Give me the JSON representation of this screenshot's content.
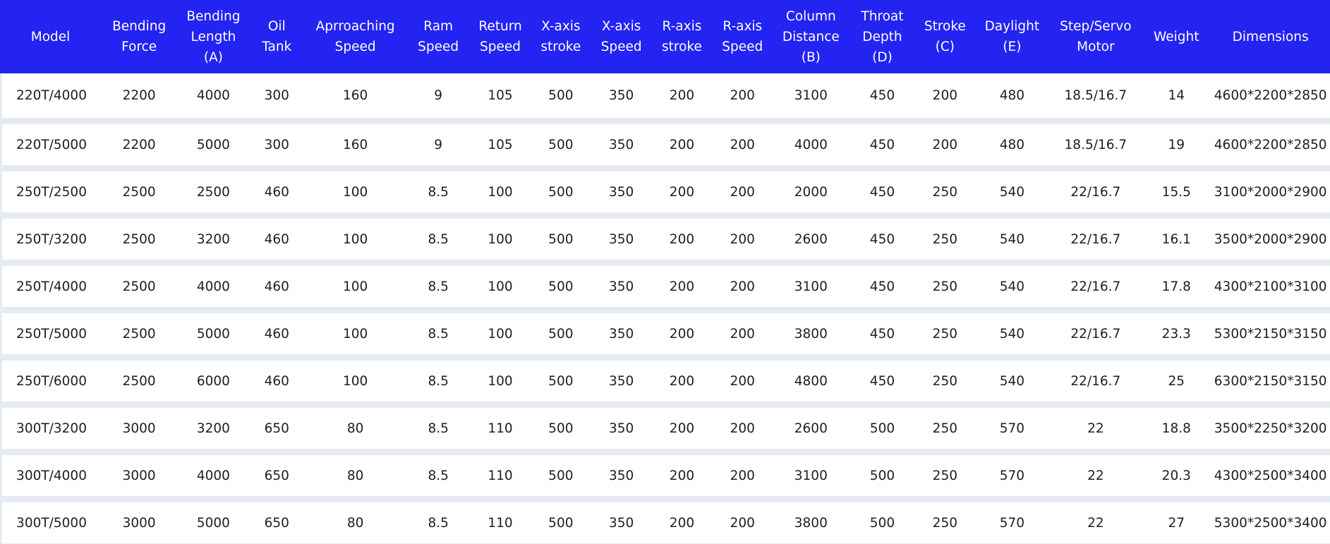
{
  "table": {
    "headers": [
      [
        "Model"
      ],
      [
        "Bending",
        "Force"
      ],
      [
        "Bending",
        "Length",
        "(A)"
      ],
      [
        "Oil",
        "Tank"
      ],
      [
        "Aprroaching",
        "Speed"
      ],
      [
        "Ram",
        "Speed"
      ],
      [
        "Return",
        "Speed"
      ],
      [
        "X-axis",
        "stroke"
      ],
      [
        "X-axis",
        "Speed"
      ],
      [
        "R-axis",
        "stroke"
      ],
      [
        "R-axis",
        "Speed"
      ],
      [
        "Column",
        "Distance",
        "(B)"
      ],
      [
        "Throat",
        "Depth",
        "(D)"
      ],
      [
        "Stroke",
        "(C)"
      ],
      [
        "Daylight",
        "(E)"
      ],
      [
        "Step/Servo",
        "Motor"
      ],
      [
        "Weight"
      ],
      [
        "Dimensions"
      ]
    ],
    "rows": [
      [
        "220T/4000",
        "2200",
        "4000",
        "300",
        "160",
        "9",
        "105",
        "500",
        "350",
        "200",
        "200",
        "3100",
        "450",
        "200",
        "480",
        "18.5/16.7",
        "14",
        "4600*2200*2850"
      ],
      [
        "220T/5000",
        "2200",
        "5000",
        "300",
        "160",
        "9",
        "105",
        "500",
        "350",
        "200",
        "200",
        "4000",
        "450",
        "200",
        "480",
        "18.5/16.7",
        "19",
        "4600*2200*2850"
      ],
      [
        "250T/2500",
        "2500",
        "2500",
        "460",
        "100",
        "8.5",
        "100",
        "500",
        "350",
        "200",
        "200",
        "2000",
        "450",
        "250",
        "540",
        "22/16.7",
        "15.5",
        "3100*2000*2900"
      ],
      [
        "250T/3200",
        "2500",
        "3200",
        "460",
        "100",
        "8.5",
        "100",
        "500",
        "350",
        "200",
        "200",
        "2600",
        "450",
        "250",
        "540",
        "22/16.7",
        "16.1",
        "3500*2000*2900"
      ],
      [
        "250T/4000",
        "2500",
        "4000",
        "460",
        "100",
        "8.5",
        "100",
        "500",
        "350",
        "200",
        "200",
        "3100",
        "450",
        "250",
        "540",
        "22/16.7",
        "17.8",
        "4300*2100*3100"
      ],
      [
        "250T/5000",
        "2500",
        "5000",
        "460",
        "100",
        "8.5",
        "100",
        "500",
        "350",
        "200",
        "200",
        "3800",
        "450",
        "250",
        "540",
        "22/16.7",
        "23.3",
        "5300*2150*3150"
      ],
      [
        "250T/6000",
        "2500",
        "6000",
        "460",
        "100",
        "8.5",
        "100",
        "500",
        "350",
        "200",
        "200",
        "4800",
        "450",
        "250",
        "540",
        "22/16.7",
        "25",
        "6300*2150*3150"
      ],
      [
        "300T/3200",
        "3000",
        "3200",
        "650",
        "80",
        "8.5",
        "110",
        "500",
        "350",
        "200",
        "200",
        "2600",
        "500",
        "250",
        "570",
        "22",
        "18.8",
        "3500*2250*3200"
      ],
      [
        "300T/4000",
        "3000",
        "4000",
        "650",
        "80",
        "8.5",
        "110",
        "500",
        "350",
        "200",
        "200",
        "3100",
        "500",
        "250",
        "570",
        "22",
        "20.3",
        "4300*2500*3400"
      ],
      [
        "300T/5000",
        "3000",
        "5000",
        "650",
        "80",
        "8.5",
        "110",
        "500",
        "350",
        "200",
        "200",
        "3800",
        "500",
        "250",
        "570",
        "22",
        "27",
        "5300*2500*3400"
      ]
    ]
  }
}
